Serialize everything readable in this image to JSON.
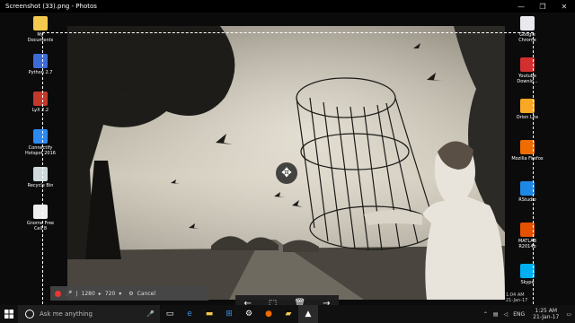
{
  "window": {
    "title": "Screenshot (33).png - Photos",
    "minimize": "—",
    "maximize": "❐",
    "close": "✕"
  },
  "desktop_icons_left": [
    {
      "label": "My Documents",
      "color": "#f2c94c"
    },
    {
      "label": "Python 2.7",
      "color": "#3d6bd6"
    },
    {
      "label": "LyX 2.2",
      "color": "#c0392b"
    },
    {
      "label": "Connectify Hotspot 2016",
      "color": "#2d89ef"
    },
    {
      "label": "Recycle Bin",
      "color": "#cfd8dc"
    },
    {
      "label": "Gnome Free Cell 8",
      "color": "#eeeeee"
    }
  ],
  "desktop_icons_right": [
    {
      "label": "Google Chrome",
      "color": "#e8eaed"
    },
    {
      "label": "Youtube Downlo...",
      "color": "#d32f2f"
    },
    {
      "label": "Orion Lite",
      "color": "#f9a825"
    },
    {
      "label": "Mozilla Firefox",
      "color": "#ef6c00"
    },
    {
      "label": "RStudio",
      "color": "#1e88e5"
    },
    {
      "label": "MATLAB R2014b",
      "color": "#e65100"
    },
    {
      "label": "Skype",
      "color": "#00aff0"
    }
  ],
  "recorder": {
    "width": "1280",
    "height": "720",
    "cancel": "Cancel"
  },
  "edit_toolbar": {
    "back": "←",
    "crop": "⬚",
    "delete": "🗑",
    "forward": "→"
  },
  "taskbar": {
    "search_placeholder": "Ask me anything",
    "language": "ENG",
    "time": "1:25 AM",
    "date": "21-Jan-17"
  },
  "ghost_clock": {
    "time": "1:04 AM",
    "date": "21-Jan-17"
  }
}
